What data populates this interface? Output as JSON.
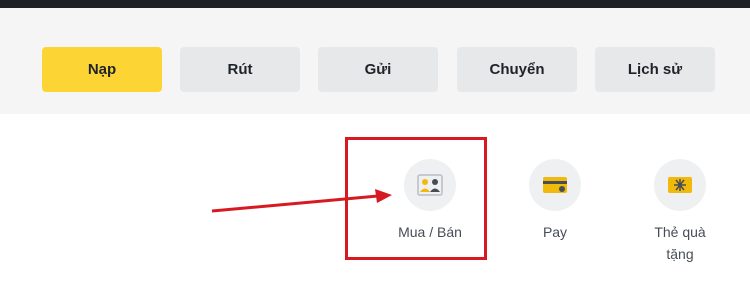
{
  "actions": {
    "deposit_label": "Nạp",
    "withdraw_label": "Rút",
    "send_label": "Gửi",
    "transfer_label": "Chuyển",
    "history_label": "Lịch sử"
  },
  "features": {
    "buy_sell": {
      "label": "Mua / Bán",
      "icon": "buy-sell-people-icon"
    },
    "pay": {
      "label": "Pay",
      "icon": "card-icon"
    },
    "gift_card": {
      "label_line1": "Thẻ quà",
      "label_line2": "tặng",
      "icon": "gift-card-icon"
    }
  },
  "colors": {
    "primary_button": "#fcd535",
    "secondary_button": "#e6e8ea",
    "annotation_red": "#d71a21",
    "icon_yellow": "#f0b90b"
  }
}
